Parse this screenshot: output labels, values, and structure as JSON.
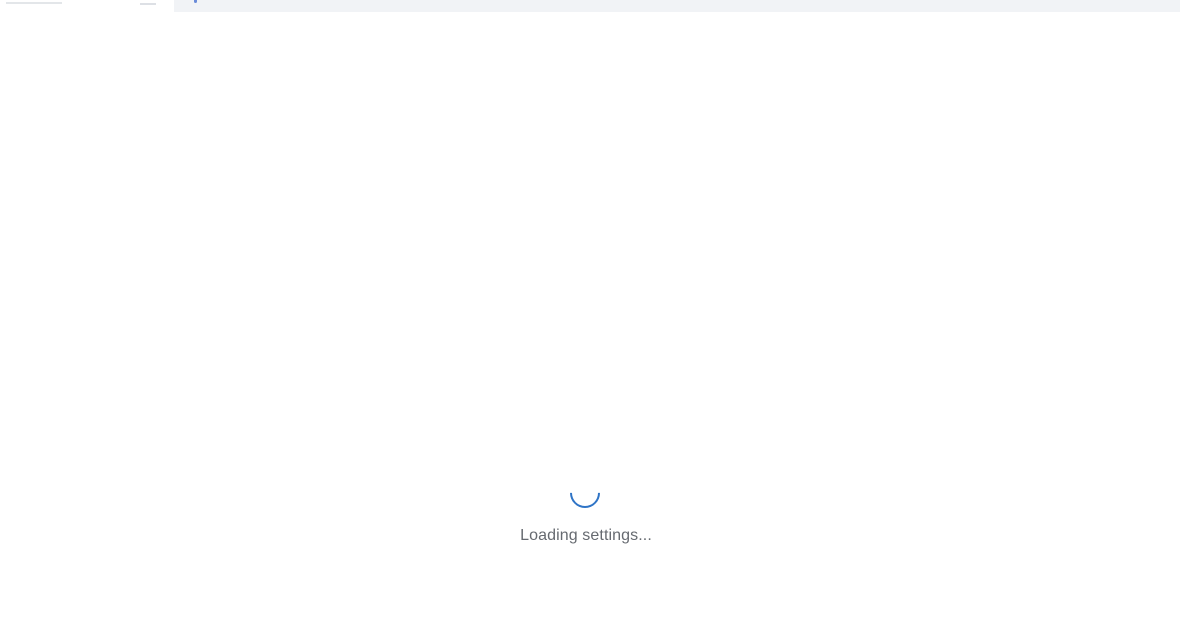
{
  "loading": {
    "message": "Loading settings..."
  },
  "colors": {
    "spinner": "#2f74c6",
    "header_bg": "#f1f3f6",
    "text": "#666a70"
  },
  "icons": {
    "spinner": "loading-spinner-icon"
  }
}
